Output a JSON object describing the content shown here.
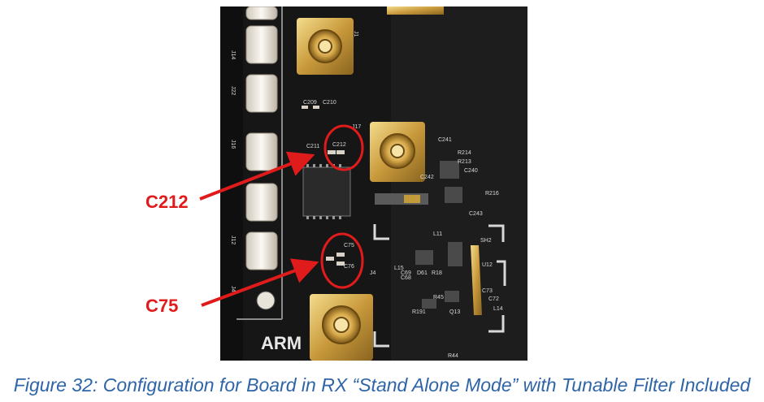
{
  "figure": {
    "caption": "Figure 32: Configuration for Board in RX “Stand Alone Mode” with Tunable Filter Included"
  },
  "callouts": [
    {
      "label": "C212"
    },
    {
      "label": "C75"
    }
  ],
  "board_silkscreen": {
    "left_connectors": [
      "J14",
      "J22",
      "J16",
      "J12",
      "J4"
    ],
    "components": [
      "J1",
      "C209",
      "C210",
      "J17",
      "C211",
      "C212",
      "C241",
      "R214",
      "R213",
      "C240",
      "C242",
      "R216",
      "C243",
      "L11",
      "C75",
      "C76",
      "C73",
      "J4",
      "L15",
      "C69",
      "C68",
      "D61",
      "R18",
      "R45",
      "R191",
      "Q13",
      "U12",
      "C72",
      "L14",
      "R44",
      "SH2"
    ],
    "brand_text": "ARM"
  },
  "colors": {
    "callout": "#e01b1b",
    "caption": "#2e64a8"
  }
}
